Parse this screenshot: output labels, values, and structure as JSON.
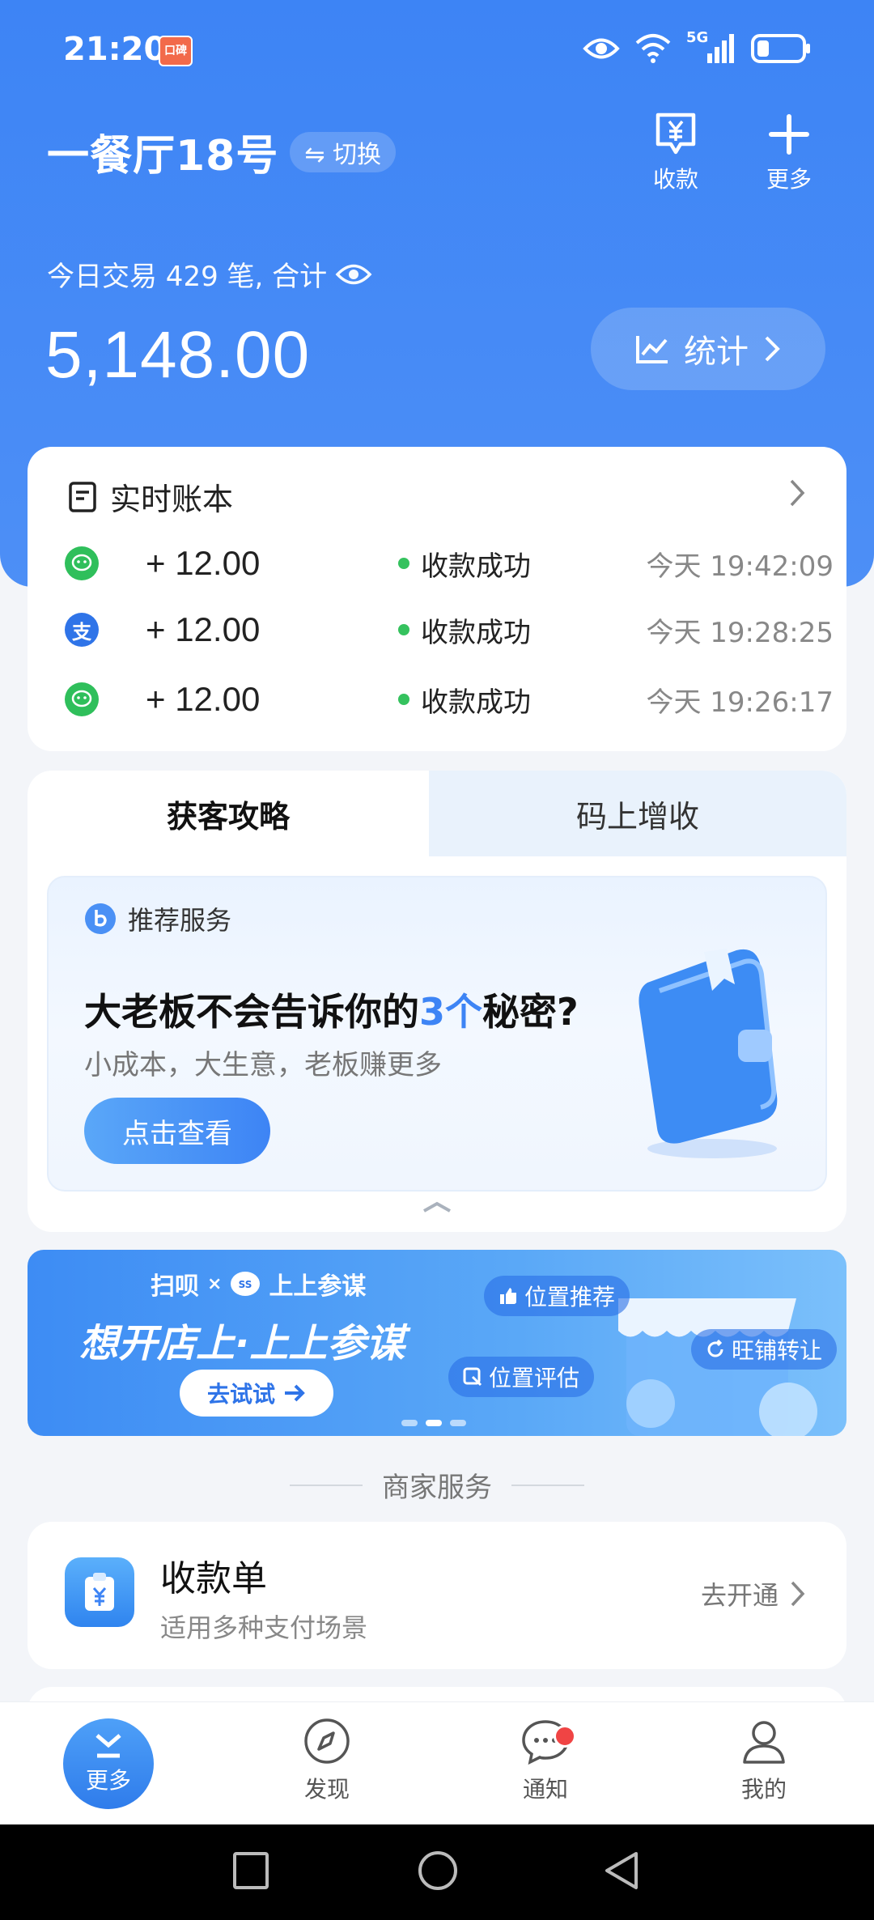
{
  "status_bar": {
    "time": "21:20",
    "badge": "口碑",
    "network": "5G"
  },
  "header": {
    "store_name": "一餐厅18号",
    "switch_label": "⇋ 切换",
    "actions": [
      {
        "label": "收款",
        "icon": "receive-money-icon"
      },
      {
        "label": "更多",
        "icon": "plus-icon"
      }
    ]
  },
  "summary": {
    "trade_text": "今日交易 429 笔, 合计",
    "amount": "5,148.00",
    "stats_label": "统计"
  },
  "ledger": {
    "title": "实时账本",
    "rows": [
      {
        "channel": "wechat",
        "amount": "+ 12.00",
        "status": "收款成功",
        "time": "今天 19:42:09"
      },
      {
        "channel": "alipay",
        "amount": "+ 12.00",
        "status": "收款成功",
        "time": "今天 19:28:25"
      },
      {
        "channel": "wechat",
        "amount": "+ 12.00",
        "status": "收款成功",
        "time": "今天 19:26:17"
      }
    ]
  },
  "promo": {
    "tabs": [
      "获客攻略",
      "码上增收"
    ],
    "rec_label": "推荐服务",
    "title_before": "大老板不会告诉你的",
    "title_highlight": "3个",
    "title_after": "秘密?",
    "subtitle": "小成本，大生意，老板赚更多",
    "button": "点击查看"
  },
  "banner": {
    "brand_left": "扫呗",
    "brand_x": "×",
    "brand_right": "上上参谋",
    "title": "想开店上·上上参谋",
    "try_label": "去试试",
    "tags": [
      "位置推荐",
      "旺铺转让",
      "位置评估"
    ]
  },
  "services": {
    "section_title": "商家服务",
    "items": [
      {
        "title": "收款单",
        "subtitle": "适用多种支付场景",
        "cta": "去开通"
      }
    ]
  },
  "tabbar": [
    {
      "label": "更多",
      "icon": "chevron-down-icon",
      "active": true
    },
    {
      "label": "发现",
      "icon": "compass-icon"
    },
    {
      "label": "通知",
      "icon": "chat-icon",
      "badge": true
    },
    {
      "label": "我的",
      "icon": "user-icon"
    }
  ],
  "colors": {
    "primary": "#3d84f5",
    "success": "#35c25e",
    "wechat": "#2fbf5b",
    "alipay": "#2f74e8",
    "badge": "#f04444"
  }
}
